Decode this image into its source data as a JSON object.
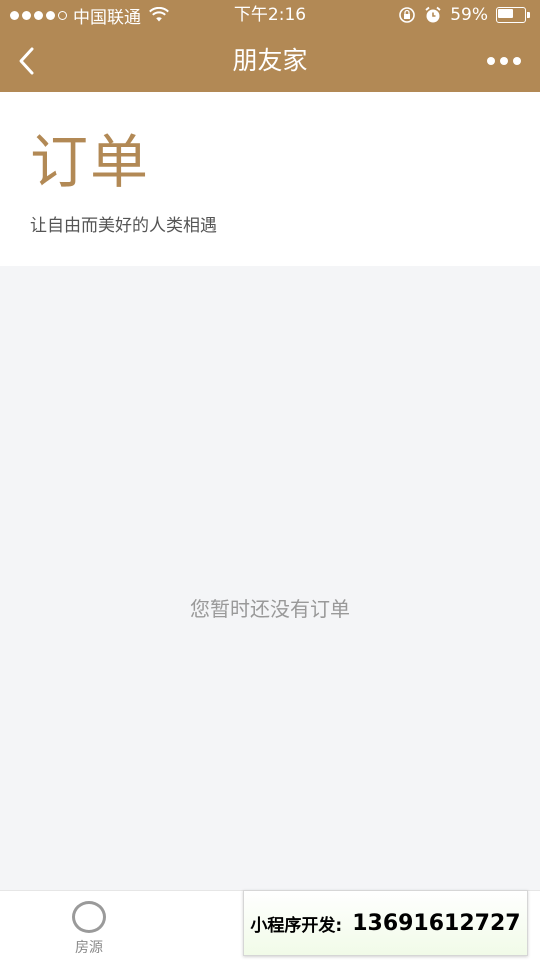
{
  "status_bar": {
    "carrier": "中国联通",
    "time": "下午2:16",
    "battery_percent": "59%",
    "battery_level": 0.59,
    "signal_filled": 4,
    "signal_total": 5,
    "icons": [
      "wifi-icon",
      "orientation-lock-icon",
      "alarm-icon",
      "battery-icon"
    ]
  },
  "nav": {
    "title": "朋友家",
    "back_icon": "chevron-left-icon",
    "more_icon": "more-dots-icon"
  },
  "header": {
    "title": "订单",
    "subtitle": "让自由而美好的人类相遇"
  },
  "content": {
    "empty_message": "您暂时还没有订单"
  },
  "tab_bar": {
    "items": [
      {
        "label": "房源",
        "icon": "circle-icon"
      }
    ]
  },
  "promo": {
    "label": "小程序开发:",
    "phone": "13691612727"
  },
  "colors": {
    "brand": "#b28955",
    "background": "#f4f5f7",
    "empty_text": "#999999"
  }
}
